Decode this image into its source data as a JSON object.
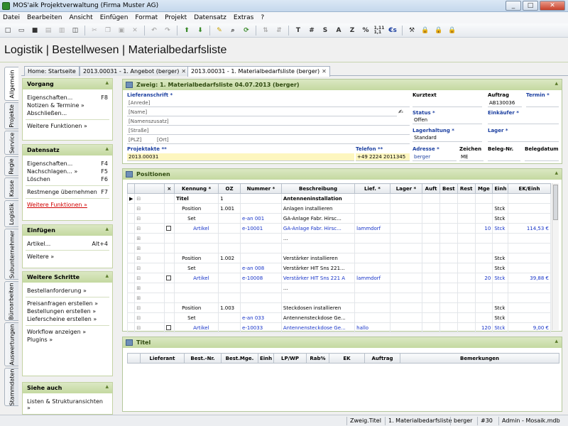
{
  "window": {
    "title": "MOS'aik Projektverwaltung (Firma Muster AG)"
  },
  "menu": [
    "Datei",
    "Bearbeiten",
    "Ansicht",
    "Einfügen",
    "Format",
    "Projekt",
    "Datensatz",
    "Extras",
    "?"
  ],
  "toolbar_text": {
    "bold_t": "T",
    "hash": "#",
    "s": "S",
    "a": "A",
    "z": "Z",
    "pct": "%",
    "num": "1,11\n1,1",
    "euro": "€s"
  },
  "app_title": "Logistik | Bestellwesen | Materialbedarfsliste",
  "vtabs": [
    "Allgemein",
    "Projekte",
    "Service",
    "Regie",
    "Kasse",
    "Logistik",
    "Subunternehmer",
    "Büroarbeiten",
    "Auswertungen",
    "Stammdaten"
  ],
  "doc_tabs": [
    {
      "label": "Home: Startseite"
    },
    {
      "label": "2013.00031 - 1. Angebot (berger)"
    },
    {
      "label": "2013.00031 - 1. Materialbedarfsliste (berger)"
    }
  ],
  "sidebar": {
    "vorgang": {
      "title": "Vorgang",
      "items": [
        {
          "label": "Eigenschaften...",
          "key": "F8"
        },
        {
          "label": "Notizen & Termine »",
          "key": ""
        },
        {
          "label": "Abschließen...",
          "key": ""
        }
      ],
      "more": "Weitere Funktionen »"
    },
    "datensatz": {
      "title": "Datensatz",
      "items": [
        {
          "label": "Eigenschaften...",
          "key": "F4"
        },
        {
          "label": "Nachschlagen... »",
          "key": "F5"
        },
        {
          "label": "Löschen",
          "key": "F6"
        }
      ],
      "extra": {
        "label": "Restmenge übernehmen",
        "key": "F7"
      },
      "more": "Weitere Funktionen »"
    },
    "einfuegen": {
      "title": "Einfügen",
      "items": [
        {
          "label": "Artikel...",
          "key": "Alt+4"
        }
      ],
      "more": "Weitere »"
    },
    "weitere": {
      "title": "Weitere Schritte",
      "items": [
        "Bestellanforderung »",
        "Preisanfragen erstellen »",
        "Bestellungen erstellen »",
        "Lieferscheine erstellen »",
        "Workflow anzeigen »",
        "Plugins »"
      ]
    },
    "siehe": {
      "title": "Siehe auch",
      "items": [
        "Listen & Strukturansichten »"
      ]
    }
  },
  "header_panel": {
    "title": "Zweig: 1. Materialbedarfsliste 04.07.2013 (berger)",
    "lieferanschrift": "Lieferanschrift *",
    "address_placeholders": [
      "[Anrede]",
      "[Name]",
      "[Namenszusatz]",
      "[Straße]",
      "[PLZ]",
      "[Ort]"
    ],
    "kurztext": "Kurztext",
    "auftrag": "Auftrag",
    "auftrag_value": "AB130036",
    "termin": "Termin *",
    "status": "Status *",
    "status_value": "Offen",
    "einkaeufer": "Einkäufer *",
    "lagerhaltung": "Lagerhaltung *",
    "lagerhaltung_value": "Standard",
    "lager": "Lager *",
    "projektakte": "Projektakte **",
    "projektakte_value": "2013.00031",
    "telefon": "Telefon **",
    "telefon_value": "+49 2224 2011345",
    "adresse": "Adresse *",
    "adresse_value": "berger",
    "zeichen": "Zeichen",
    "zeichen_value": "ME",
    "belegnr": "Beleg-Nr.",
    "belegdatum": "Belegdatum"
  },
  "positions": {
    "title": "Positionen",
    "columns": [
      "",
      "",
      "×",
      "Kennung *",
      "OZ",
      "Nummer *",
      "Beschreibung",
      "Lief. *",
      "Lager *",
      "Auft",
      "Best",
      "Rest",
      "Mge",
      "Einh",
      "EK/Einh"
    ],
    "rows": [
      {
        "k": "Titel",
        "oz": "1",
        "n": "",
        "d": "Antenneninstallation",
        "l": "",
        "m": "",
        "e": "",
        "ek": "",
        "blue": false,
        "bold": true
      },
      {
        "k": "Position",
        "oz": "1.001",
        "n": "",
        "d": "Anlagen installieren",
        "l": "",
        "m": "",
        "e": "Stck",
        "ek": "",
        "blue": false
      },
      {
        "k": "Set",
        "oz": "",
        "n": "e-an 001",
        "d": "GA-Anlage Fabr. Hirsc...",
        "l": "",
        "m": "",
        "e": "Stck",
        "ek": "",
        "blue": false,
        "nblue": true
      },
      {
        "k": "Artikel",
        "oz": "",
        "n": "e-10001",
        "d": "GA-Anlage Fabr. Hirsc...",
        "l": "lammdorf",
        "m": "10",
        "e": "Stck",
        "ek": "114,53 €",
        "blue": true,
        "chk": true
      },
      {
        "k": "",
        "oz": "",
        "n": "",
        "d": "...",
        "l": "",
        "m": "",
        "e": "",
        "ek": ""
      },
      {
        "k": "",
        "oz": "",
        "n": "",
        "d": "",
        "l": "",
        "m": "",
        "e": "",
        "ek": ""
      },
      {
        "k": "Position",
        "oz": "1.002",
        "n": "",
        "d": "Verstärker installieren",
        "l": "",
        "m": "",
        "e": "Stck",
        "ek": ""
      },
      {
        "k": "Set",
        "oz": "",
        "n": "e-an 008",
        "d": "Verstärker HIT Sns 221...",
        "l": "",
        "m": "",
        "e": "Stck",
        "ek": "",
        "nblue": true
      },
      {
        "k": "Artikel",
        "oz": "",
        "n": "e-10008",
        "d": "Verstärker HIT Sns 221 A",
        "l": "lammdorf",
        "m": "20",
        "e": "Stck",
        "ek": "39,88 €",
        "blue": true,
        "chk": true
      },
      {
        "k": "",
        "oz": "",
        "n": "",
        "d": "...",
        "l": "",
        "m": "",
        "e": "",
        "ek": ""
      },
      {
        "k": "",
        "oz": "",
        "n": "",
        "d": "",
        "l": "",
        "m": "",
        "e": "",
        "ek": ""
      },
      {
        "k": "Position",
        "oz": "1.003",
        "n": "",
        "d": "Steckdosen installieren",
        "l": "",
        "m": "",
        "e": "Stck",
        "ek": ""
      },
      {
        "k": "Set",
        "oz": "",
        "n": "e-an 033",
        "d": "Antennensteckdose Ge...",
        "l": "",
        "m": "",
        "e": "Stck",
        "ek": "",
        "nblue": true
      },
      {
        "k": "Artikel",
        "oz": "",
        "n": "e-10033",
        "d": "Antennensteckdose Ge...",
        "l": "hallo",
        "m": "120",
        "e": "Stck",
        "ek": "9,00 €",
        "blue": true,
        "chk": true
      }
    ]
  },
  "titel_panel": {
    "title": "Titel",
    "columns": [
      "",
      "Lieferant",
      "Best.-Nr.",
      "Best.Mge.",
      "Einh",
      "LP/WP",
      "Rab%",
      "EK",
      "Auftrag",
      "Bemerkungen"
    ]
  },
  "status": [
    "Zweig.Titel",
    "1. Materialbedarfsliste",
    "berger",
    "#30",
    "Admin - Mosaik.mdb"
  ]
}
